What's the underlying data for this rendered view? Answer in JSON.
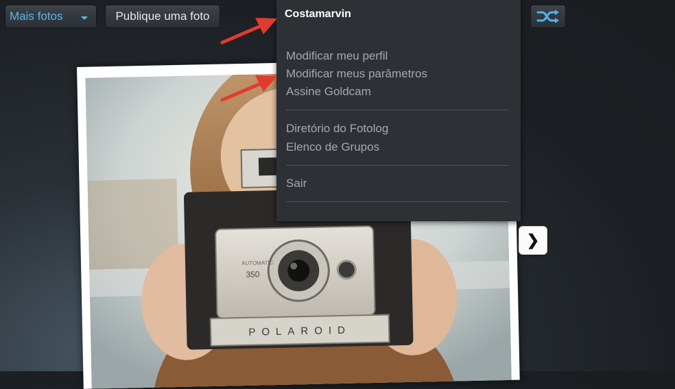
{
  "toolbar": {
    "more_photos_label": "Mais fotos",
    "publish_label": "Publique uma foto"
  },
  "user_menu": {
    "username": "Costamarvin",
    "group1": [
      "Modificar meu perfil",
      "Modificar meus parâmetros",
      "Assine Goldcam"
    ],
    "group2": [
      "Diretório do Fotolog",
      "Elenco de Grupos"
    ],
    "group3": [
      "Sair"
    ]
  },
  "photo": {
    "camera_brand": "POLAROID",
    "camera_model": "350",
    "camera_line": "AUTOMATIC"
  },
  "navigation": {
    "next_glyph": "❯"
  },
  "colors": {
    "accent": "#5bb7f0",
    "annotation": "#e23b2e",
    "menu_bg": "#2d3135"
  },
  "icons": {
    "shuffle": "shuffle-icon",
    "dropdown": "chevron-down-icon",
    "next": "chevron-right-icon"
  }
}
